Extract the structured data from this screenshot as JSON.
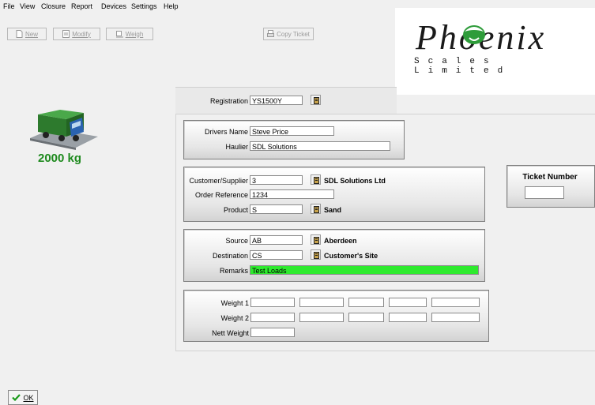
{
  "menu": [
    "File",
    "View",
    "Closure",
    "Report",
    "Devices",
    "Settings",
    "Help"
  ],
  "toolbar": {
    "new_label": "New",
    "modify_label": "Modify",
    "weigh_label": "Weigh",
    "copy_ticket_label": "Copy Ticket"
  },
  "logo": {
    "brand": "Phoenix",
    "tagline": "Scales Limited"
  },
  "scale": {
    "weight_display": "2000 kg"
  },
  "registration": {
    "label": "Registration",
    "value": "YS1500Y"
  },
  "driver": {
    "drivers_name_label": "Drivers Name",
    "drivers_name_value": "Steve Price",
    "haulier_label": "Haulier",
    "haulier_value": "SDL Solutions"
  },
  "order": {
    "customer_label": "Customer/Supplier",
    "customer_code": "3",
    "customer_name": "SDL Solutions Ltd",
    "order_ref_label": "Order Reference",
    "order_ref_value": "1234",
    "product_label": "Product",
    "product_code": "S",
    "product_name": "Sand"
  },
  "location": {
    "source_label": "Source",
    "source_code": "AB",
    "source_name": "Aberdeen",
    "destination_label": "Destination",
    "destination_code": "CS",
    "destination_name": "Customer's Site",
    "remarks_label": "Remarks",
    "remarks_value": "Test Loads",
    "remarks_color": "#2eea2e"
  },
  "weights": {
    "weight1_label": "Weight 1",
    "weight2_label": "Weight 2",
    "nett_label": "Nett Weight"
  },
  "ticket": {
    "label": "Ticket Number",
    "value": ""
  },
  "footer": {
    "ok_label": "OK"
  },
  "icons": [
    "lookup-icon",
    "truck-icon",
    "new-icon",
    "modify-icon",
    "weigh-icon",
    "copy-ticket-icon",
    "check-icon"
  ]
}
